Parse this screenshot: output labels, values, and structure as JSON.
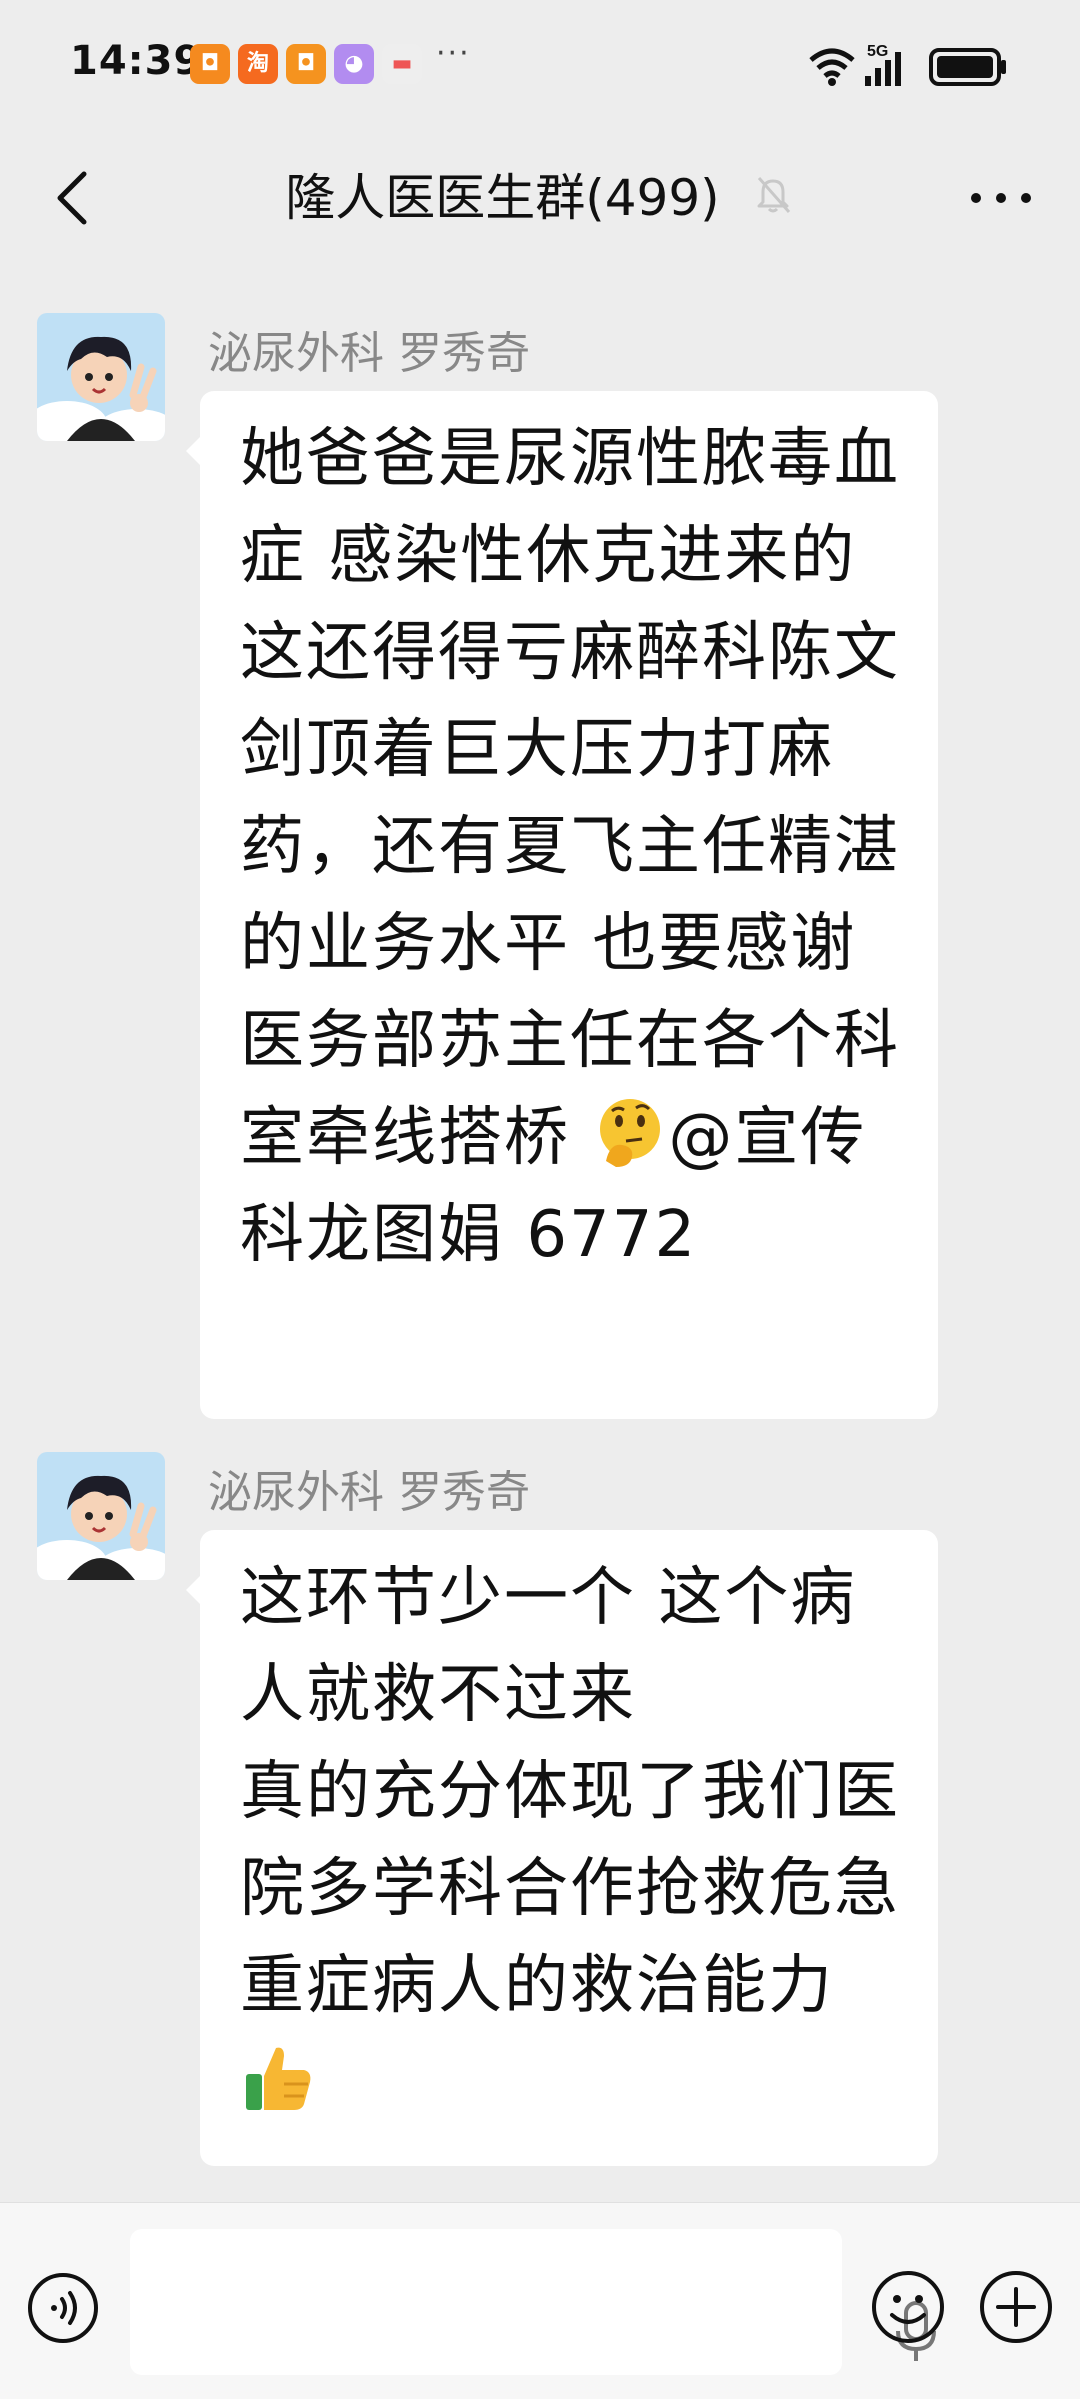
{
  "status_bar": {
    "time": "14:39",
    "network": "5G",
    "overflow": "···",
    "notifications": [
      {
        "icon": "app-notification-icon",
        "color": "#f58a1f",
        "glyph": "◘"
      },
      {
        "icon": "taobao-icon",
        "color": "#f56a1f",
        "glyph": "淘"
      },
      {
        "icon": "app-notification-icon",
        "color": "#f5931f",
        "glyph": "◘"
      },
      {
        "icon": "assistant-app-icon",
        "color": "#b28cf0",
        "glyph": "◕"
      },
      {
        "icon": "wallet-app-icon",
        "color": "#eeeeee",
        "glyph": "▬"
      }
    ]
  },
  "header": {
    "title": "隆人医医生群(499)"
  },
  "messages": [
    {
      "sender": "泌尿外科 罗秀奇",
      "text_before": "她爸爸是尿源性脓毒血症 感染性休克进来的 这还得得亏麻醉科陈文剑顶着巨大压力打麻药，还有夏飞主任精湛的业务水平 也要感谢医务部苏主任在各个科室牵线搭桥 ",
      "emoji": "thinking-face-emoji",
      "text_after": "@宣传科龙图娟 6772"
    },
    {
      "sender": "泌尿外科 罗秀奇",
      "text_before": "这环节少一个 这个病人就救不过来\n真的充分体现了我们医院多学科合作抢救危急重症病人的救治能力",
      "emoji": "thumbs-up-emoji",
      "text_after": ""
    }
  ],
  "colors": {
    "background": "#ededed",
    "bubble": "#ffffff",
    "sender": "#888888",
    "input_bar": "#f7f7f7"
  }
}
